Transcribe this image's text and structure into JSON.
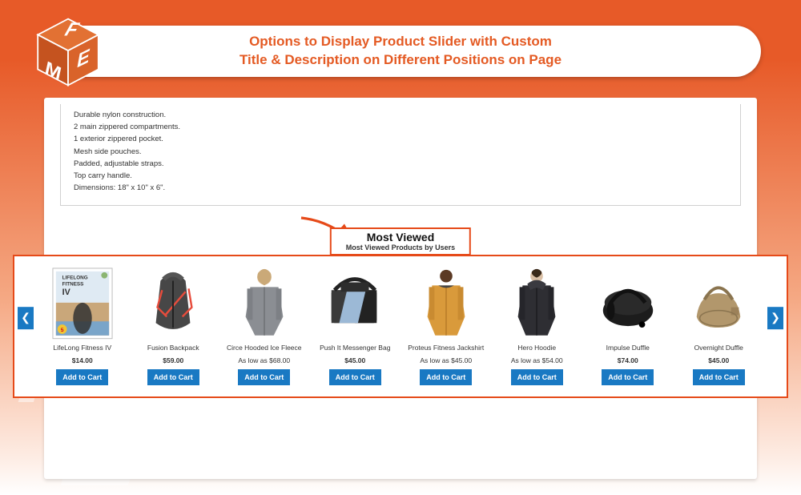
{
  "banner": {
    "line1": "Options to Display Product Slider with Custom",
    "line2": "Title & Description on Different Positions on Page"
  },
  "description_panel": {
    "lines": [
      "Durable nylon construction.",
      "2 main zippered compartments.",
      "1 exterior zippered pocket.",
      "Mesh side pouches.",
      "Padded, adjustable straps.",
      "Top carry handle.",
      "Dimensions: 18\" x 10\" x 6\"."
    ]
  },
  "slider": {
    "title": "Most Viewed",
    "subtitle": "Most Viewed Products by Users",
    "add_to_cart_label": "Add to Cart",
    "products": [
      {
        "name": "LifeLong Fitness IV",
        "price_label": "$14.00"
      },
      {
        "name": "Fusion Backpack",
        "price_label": "$59.00"
      },
      {
        "name": "Circe Hooded Ice Fleece",
        "price_label": "As low as $68.00"
      },
      {
        "name": "Push It Messenger Bag",
        "price_label": "$45.00"
      },
      {
        "name": "Proteus Fitness Jackshirt",
        "price_label": "As low as $45.00"
      },
      {
        "name": "Hero Hoodie",
        "price_label": "As low as $54.00"
      },
      {
        "name": "Impulse Duffle",
        "price_label": "$74.00"
      },
      {
        "name": "Overnight Duffle",
        "price_label": "$45.00"
      }
    ]
  }
}
